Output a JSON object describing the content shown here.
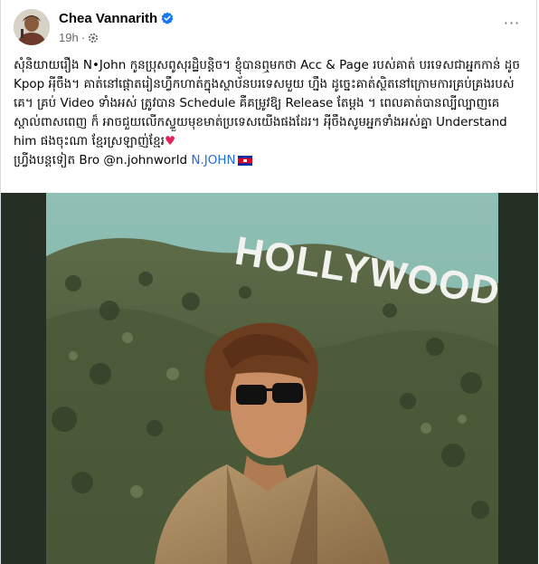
{
  "post": {
    "author": "Chea Vannarith",
    "time": "19h",
    "separator": "·",
    "more_label": "···",
    "body_line_1": "សុំនិយាយរឿង N•John កូនប្រុសពូសុរដ្ឋិបន្តិច។ ខ្ញុំបានឮមកថា Acc & Page របស់គាត់ បរទេសជាអ្នកកាន់ ដូច Kpop អុីចឹង។ គាត់នៅផ្តោតរៀនហ្វឹកហាត់ក្នុងស្ថាប័នបរទេសមួយ ហ្នឹង ដូច្នេះគាត់ស្ថិតនៅក្រោមការគ្រប់គ្រងរបស់គេ។ គ្រប់ Video ទាំងអស់ ត្រូវបាន Schedule គឺគម្រូវឱ្យ Release តែម្តង ។ ពេលគាត់បានល្បីល្បាញគេស្គាល់ពាសពេញ ក៏ អាចជួយលើកស្ទួយមុខមាត់ប្រទេសយើងផងដែរ។ អុីចឹងសូមអ្នកទាំងអស់គ្នា Understand him ផងចុះណា ខ្មែរស្រឡាញ់ខ្មែរ",
    "heart": "♥",
    "body_line_2_prefix": "ហ្រ្វីងបន្តទៀត Bro ",
    "mention": "@n.johnworld",
    "hashtag": "N.JOHN",
    "image_text": "HOLLYWOOD",
    "colors": {
      "link": "#216fdb",
      "verified": "#1877f2",
      "heart": "#e0245e"
    }
  }
}
